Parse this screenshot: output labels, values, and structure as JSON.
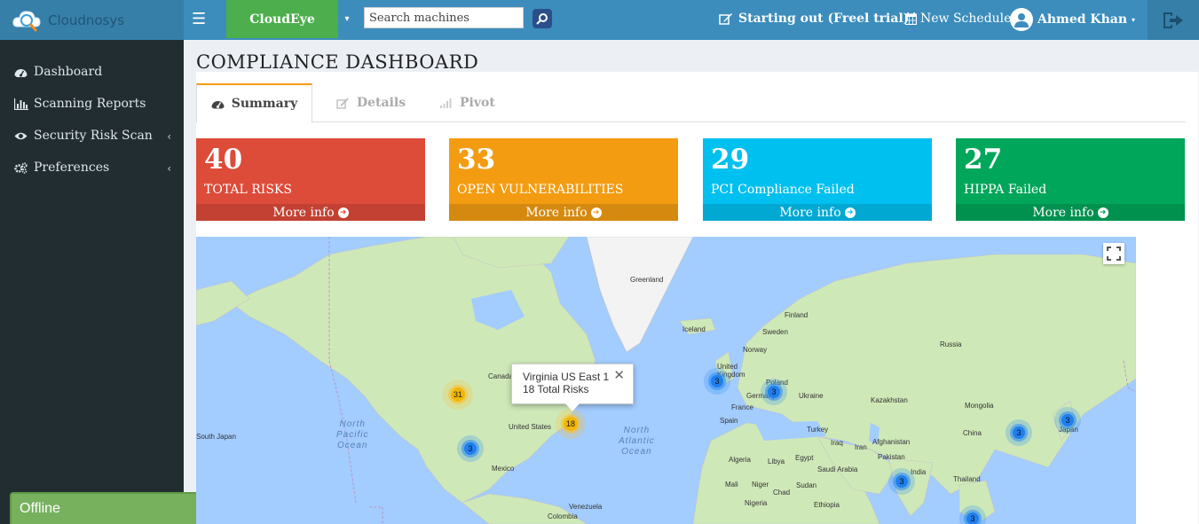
{
  "header": {
    "logo_text": "Cloudnosys",
    "project_label": "CloudEye",
    "search_placeholder": "Search machines",
    "trial_label": "Starting out (Freel trial)",
    "schedule_label": "New Schedule!",
    "user_name": "Ahmed Khan"
  },
  "sidebar": {
    "items": [
      {
        "label": "Dashboard",
        "icon": "dashboard-icon"
      },
      {
        "label": "Scanning Reports",
        "icon": "bar-chart-icon"
      },
      {
        "label": "Security Risk Scan",
        "icon": "eye-icon"
      },
      {
        "label": "Preferences",
        "icon": "cogs-icon"
      }
    ],
    "offline_label": "Offline"
  },
  "main": {
    "title": "COMPLIANCE DASHBOARD",
    "tabs": [
      {
        "label": "Summary"
      },
      {
        "label": "Details"
      },
      {
        "label": "Pivot"
      }
    ],
    "boxes": [
      {
        "value": "40",
        "label": "TOTAL RISKS",
        "more": "More info",
        "color": "#dd4b39"
      },
      {
        "value": "33",
        "label": "OPEN VULNERABILITIES",
        "more": "More info",
        "color": "#f39c12"
      },
      {
        "value": "29",
        "label": "PCI Compliance Failed",
        "more": "More info",
        "color": "#00c0ef"
      },
      {
        "value": "27",
        "label": "HIPPA Failed",
        "more": "More info",
        "color": "#00a65a"
      }
    ]
  },
  "map": {
    "popup_line1": "Virginia US East 1",
    "popup_line2": "18 Total Risks",
    "clusters": [
      "31",
      "18",
      "3",
      "3",
      "3",
      "3",
      "3",
      "3",
      "3",
      "3"
    ],
    "countries": [
      "Greenland",
      "Finland",
      "Sweden",
      "Iceland",
      "Norway",
      "United Kingdom",
      "Poland",
      "Germany",
      "Ukraine",
      "France",
      "Spain",
      "Russia",
      "Kazakhstan",
      "Mongolia",
      "Turkey",
      "Iraq",
      "Iran",
      "Afghanistan",
      "Pakistan",
      "China",
      "India",
      "Japan",
      "Thailand",
      "Canada",
      "United States",
      "Mexico",
      "Venezuela",
      "Colombia",
      "Algeria",
      "Libya",
      "Egypt",
      "Saudi Arabia",
      "Mali",
      "Niger",
      "Chad",
      "Sudan",
      "Nigeria",
      "Ethiopia",
      "South Japan"
    ],
    "oceans": [
      "North Pacific Ocean",
      "North Atlantic Ocean"
    ]
  }
}
